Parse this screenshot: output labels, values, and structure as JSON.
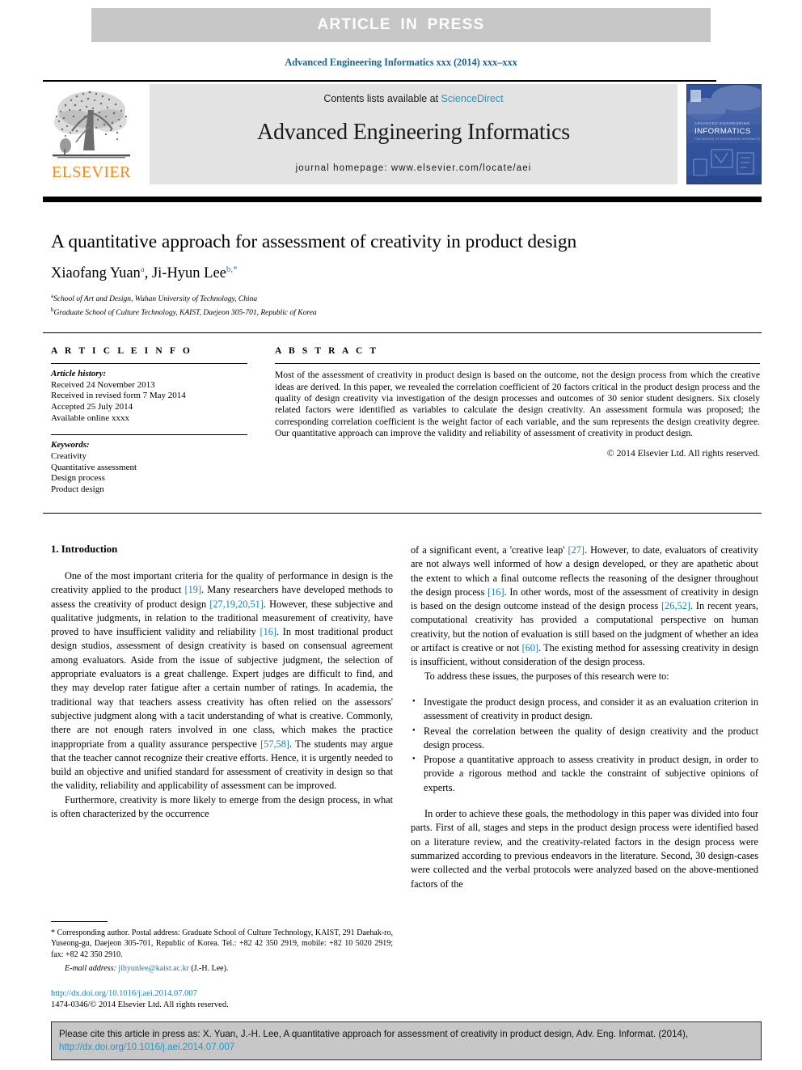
{
  "banner": {
    "text": "ARTICLE  IN  PRESS"
  },
  "journal_ref": "Advanced Engineering Informatics xxx (2014) xxx–xxx",
  "masthead": {
    "contents_prefix": "Contents lists available at ",
    "sciencedirect": "ScienceDirect",
    "journal_title": "Advanced Engineering Informatics",
    "homepage": "journal homepage: www.elsevier.com/locate/aei",
    "publisher_word": "ELSEVIER",
    "cover_line1": "ADVANCED ENGINEERING",
    "cover_line2": "INFORMATICS",
    "cover_line3": "THE SCIENCE OF ENGINEERING INFORMATION SYSTEMS"
  },
  "article": {
    "title": "A quantitative approach for assessment of creativity in product design",
    "authors": [
      {
        "name": "Xiaofang Yuan",
        "marks": "a"
      },
      {
        "name": "Ji-Hyun Lee",
        "marks": "b,*"
      }
    ],
    "affiliations": [
      {
        "mark": "a",
        "text": "School of Art and Design, Wuhan University of Technology, China"
      },
      {
        "mark": "b",
        "text": "Graduate School of Culture Technology, KAIST, Daejeon 305-701, Republic of Korea"
      }
    ]
  },
  "article_info": {
    "heading": "A R T I C L E   I N F O",
    "history_label": "Article history:",
    "history": [
      "Received 24 November 2013",
      "Received in revised form 7 May 2014",
      "Accepted 25 July 2014",
      "Available online xxxx"
    ],
    "keywords_label": "Keywords:",
    "keywords": [
      "Creativity",
      "Quantitative assessment",
      "Design process",
      "Product design"
    ]
  },
  "abstract": {
    "heading": "A B S T R A C T",
    "text": "Most of the assessment of creativity in product design is based on the outcome, not the design process from which the creative ideas are derived. In this paper, we revealed the correlation coefficient of 20 factors critical in the product design process and the quality of design creativity via investigation of the design processes and outcomes of 30 senior student designers. Six closely related factors were identified as variables to calculate the design creativity. An assessment formula was proposed; the corresponding correlation coefficient is the weight factor of each variable, and the sum represents the design creativity degree. Our quantitative approach can improve the validity and reliability of assessment of creativity in product design.",
    "copyright": "© 2014 Elsevier Ltd. All rights reserved."
  },
  "body": {
    "section_heading": "1. Introduction",
    "left_p1_a": "One of the most important criteria for the quality of performance in design is the creativity applied to the product ",
    "left_p1_r1": "[19]",
    "left_p1_b": ". Many researchers have developed methods to assess the creativity of product design ",
    "left_p1_r2": "[27,19,20,51]",
    "left_p1_c": ". However, these subjective and qualitative judgments, in relation to the traditional measurement of creativity, have proved to have insufficient validity and reliability ",
    "left_p1_r3": "[16]",
    "left_p1_d": ". In most traditional product design studios, assessment of design creativity is based on consensual agreement among evaluators. Aside from the issue of subjective judgment, the selection of appropriate evaluators is a great challenge. Expert judges are difficult to find, and they may develop rater fatigue after a certain number of ratings. In academia, the traditional way that teachers assess creativity has often relied on the assessors' subjective judgment along with a tacit understanding of what is creative. Commonly, there are not enough raters involved in one class, which makes the practice inappropriate from a quality assurance perspective ",
    "left_p1_r4": "[57,58]",
    "left_p1_e": ". The students may argue that the teacher cannot recognize their creative efforts. Hence, it is urgently needed to build an objective and unified standard for assessment of creativity in design so that the validity, reliability and applicability of assessment can be improved.",
    "left_p2": "Furthermore, creativity is more likely to emerge from the design process, in what is often characterized by the occurrence",
    "right_p1_a": "of a significant event, a 'creative leap' ",
    "right_p1_r1": "[27]",
    "right_p1_b": ". However, to date, evaluators of creativity are not always well informed of how a design developed, or they are apathetic about the extent to which a final outcome reflects the reasoning of the designer throughout the design process ",
    "right_p1_r2": "[16]",
    "right_p1_c": ". In other words, most of the assessment of creativity in design is based on the design outcome instead of the design process ",
    "right_p1_r3": "[26,52]",
    "right_p1_d": ". In recent years, computational creativity has provided a computational perspective on human creativity, but the notion of evaluation is still based on the judgment of whether an idea or artifact is creative or not ",
    "right_p1_r4": "[60]",
    "right_p1_e": ". The existing method for assessing creativity in design is insufficient, without consideration of the design process.",
    "right_p2": "To address these issues, the purposes of this research were to:",
    "bullets": [
      "Investigate the product design process, and consider it as an evaluation criterion in assessment of creativity in product design.",
      "Reveal the correlation between the quality of design creativity and the product design process.",
      "Propose a quantitative approach to assess creativity in product design, in order to provide a rigorous method and tackle the constraint of subjective opinions of experts."
    ],
    "right_p3": "In order to achieve these goals, the methodology in this paper was divided into four parts. First of all, stages and steps in the product design process were identified based on a literature review, and the creativity-related factors in the design process were summarized according to previous endeavors in the literature. Second, 30 design-cases were collected and the verbal protocols were analyzed based on the above-mentioned factors of the"
  },
  "footnote": {
    "mark": "*",
    "text": " Corresponding author. Postal address: Graduate School of Culture Technology, KAIST, 291 Daehak-ro, Yuseong-gu, Daejeon 305-701, Republic of Korea. Tel.: +82 42 350 2919, mobile: +82 10 5020 2919; fax: +82 42 350 2910.",
    "email_label": "E-mail address:",
    "email": "jihyunlee@kaist.ac.kr",
    "email_suffix": " (J.-H. Lee)."
  },
  "doi_footer": {
    "doi_link": "http://dx.doi.org/10.1016/j.aei.2014.07.007",
    "issn_line": "1474-0346/© 2014 Elsevier Ltd. All rights reserved."
  },
  "cite_box": {
    "line1": "Please cite this article in press as: X. Yuan, J.-H. Lee, A quantitative approach for assessment of creativity in product design, Adv. Eng. Informat. (2014),",
    "line2": "http://dx.doi.org/10.1016/j.aei.2014.07.007"
  },
  "colors": {
    "link_blue": "#1a7fb5",
    "sciencedirect_blue": "#2196c8",
    "elsevier_orange": "#ec8b23",
    "banner_gray": "#c7c7c7",
    "masthead_gray": "#e3e3e3",
    "cover_blue": "#31529c"
  }
}
